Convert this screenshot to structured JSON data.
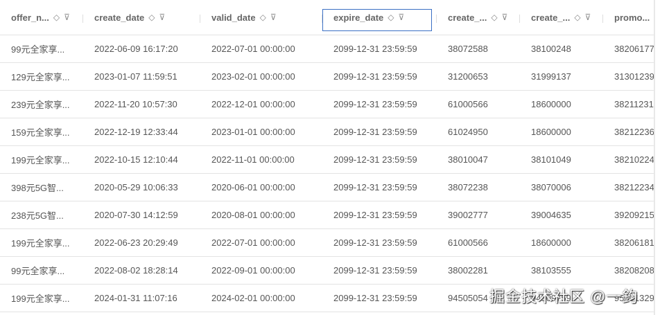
{
  "columns": [
    "offer_n...",
    "create_date",
    "valid_date",
    "expire_date",
    "create_...",
    "create_...",
    "promo..."
  ],
  "rows": [
    [
      "99元全家享...",
      "2022-06-09 16:17:20",
      "2022-07-01 00:00:00",
      "2099-12-31 23:59:59",
      "38072588",
      "38100248",
      "38206177"
    ],
    [
      "129元全家享...",
      "2023-01-07 11:59:51",
      "2023-02-01 00:00:00",
      "2099-12-31 23:59:59",
      "31200653",
      "31999137",
      "31301239"
    ],
    [
      "239元全家享...",
      "2022-11-20 10:57:30",
      "2022-12-01 00:00:00",
      "2099-12-31 23:59:59",
      "61000566",
      "18600000",
      "38211231"
    ],
    [
      "159元全家享...",
      "2022-12-19 12:33:44",
      "2023-01-01 00:00:00",
      "2099-12-31 23:59:59",
      "61024950",
      "18600000",
      "38212236"
    ],
    [
      "199元全家享...",
      "2022-10-15 12:10:44",
      "2022-11-01 00:00:00",
      "2099-12-31 23:59:59",
      "38010047",
      "38101049",
      "38210224"
    ],
    [
      "398元5G智...",
      "2020-05-29 10:06:33",
      "2020-06-01 00:00:00",
      "2099-12-31 23:59:59",
      "38072238",
      "38070006",
      "38212234"
    ],
    [
      "238元5G智...",
      "2020-07-30 14:12:59",
      "2020-08-01 00:00:00",
      "2099-12-31 23:59:59",
      "39002777",
      "39004635",
      "39209215"
    ],
    [
      "199元全家享...",
      "2022-06-23 20:29:49",
      "2022-07-01 00:00:00",
      "2099-12-31 23:59:59",
      "61000566",
      "18600000",
      "38206181"
    ],
    [
      "99元全家享...",
      "2022-08-02 18:28:14",
      "2022-09-01 00:00:00",
      "2099-12-31 23:59:59",
      "38002281",
      "38103555",
      "38208208"
    ],
    [
      "199元全家享...",
      "2024-01-31 11:07:16",
      "2024-02-01 00:00:00",
      "2099-12-31 23:59:59",
      "94505054",
      "94509759",
      "95401329"
    ]
  ],
  "watermark": "掘金技术社区 @一鈞"
}
